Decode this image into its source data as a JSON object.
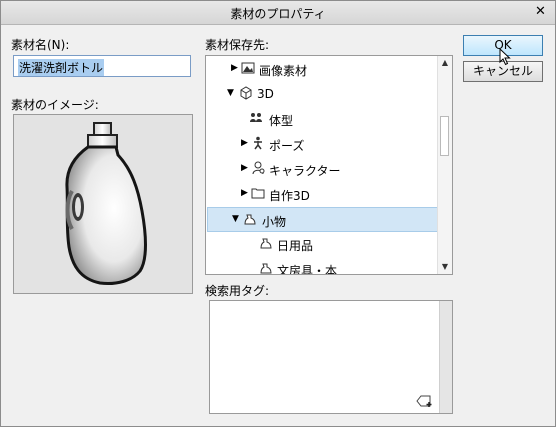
{
  "window": {
    "title": "素材のプロパティ"
  },
  "name_field": {
    "label": "素材名(N):",
    "value": "洗濯洗剤ボトル"
  },
  "image_section": {
    "label": "素材のイメージ:"
  },
  "location": {
    "label": "素材保存先:",
    "items": [
      {
        "label": "画像素材",
        "expanded": false,
        "selected": false
      },
      {
        "label": "3D",
        "expanded": true,
        "selected": false
      },
      {
        "label": "体型",
        "expanded": false,
        "selected": false
      },
      {
        "label": "ポーズ",
        "expanded": false,
        "selected": false
      },
      {
        "label": "キャラクター",
        "expanded": false,
        "selected": false
      },
      {
        "label": "自作3D",
        "expanded": false,
        "selected": false
      },
      {
        "label": "小物",
        "expanded": true,
        "selected": true
      },
      {
        "label": "日用品",
        "expanded": false,
        "selected": false
      },
      {
        "label": "文房具・本",
        "expanded": false,
        "selected": false
      }
    ]
  },
  "tags": {
    "label": "検索用タグ:"
  },
  "buttons": {
    "ok": "OK",
    "cancel": "キャンセル"
  },
  "colors": {
    "selection": "#d2e6f6",
    "input_highlight": "#a9cdf0"
  }
}
